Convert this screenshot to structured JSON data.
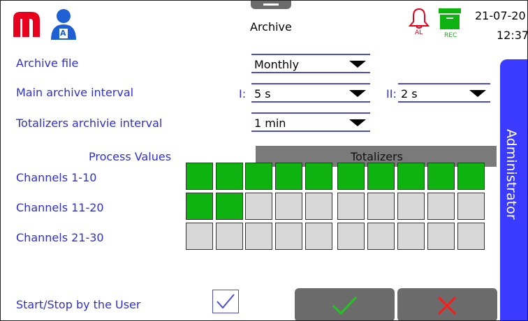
{
  "header": {
    "title": "Archive",
    "date": "21-07-20",
    "time": "12:37",
    "alarm_badge": "AL",
    "rec_badge": "REC",
    "user_initial": "A"
  },
  "side_tab": {
    "label": "Administrator"
  },
  "form": {
    "archive_file": {
      "label": "Archive file",
      "value": "Monthly"
    },
    "main_interval": {
      "label": "Main archive interval",
      "i_label": "I:",
      "i_value": "5 s",
      "ii_label": "II:",
      "ii_value": "2 s"
    },
    "totalizers_interval": {
      "label": "Totalizers archivie interval",
      "value": "1 min"
    }
  },
  "tabs": {
    "process_values": "Process Values",
    "totalizers": "Totalizers"
  },
  "channels": [
    {
      "label": "Channels 1-10",
      "states": [
        1,
        1,
        1,
        1,
        1,
        1,
        1,
        1,
        1,
        1
      ]
    },
    {
      "label": "Channels 11-20",
      "states": [
        1,
        1,
        0,
        0,
        0,
        0,
        0,
        0,
        0,
        0
      ]
    },
    {
      "label": "Channels 21-30",
      "states": [
        0,
        0,
        0,
        0,
        0,
        0,
        0,
        0,
        0,
        0
      ]
    }
  ],
  "start_stop": {
    "label": "Start/Stop by the User",
    "checked": true
  },
  "colors": {
    "accent": "#3b3bff",
    "label_text": "#2f2fcf",
    "on": "#0fb30f",
    "off": "#d8d8d8",
    "button": "#6b6b6b",
    "logo": "#e8001c",
    "confirm": "#22c622",
    "cancel": "#ff1a1a"
  }
}
